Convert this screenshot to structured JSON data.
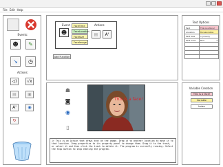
{
  "menu": [
    "File",
    "Edit",
    "Help"
  ],
  "left_panel": {
    "events_label": "Events:",
    "actions_label": "Actions:"
  },
  "editor": {
    "event_label": "Event",
    "actions_label": "Actions",
    "event_options": [
      "FaceTime",
      "FaceLocation",
      "FaceSize",
      "FaceImage"
    ],
    "add_function": "Add Function"
  },
  "text_options": {
    "title": "Text Options",
    "rows": [
      {
        "key": "Text",
        "value": "This is a face!"
      },
      {
        "key": "Location",
        "value": "FaceLocation"
      },
      {
        "key": "Text Size",
        "value": "1 (count)"
      },
      {
        "key": "Text Color",
        "value": "Red"
      }
    ]
  },
  "variable_creation": {
    "title": "Variable Creation",
    "items": [
      "This is a face!",
      "Variable",
      "Index"
    ]
  },
  "video_overlay_text": "This is a face!",
  "code_text": "1> This is an Action that draws text on the image. Drag it to another location to move it to that location. Drag properties to its property panel to change them. Drag it to the trash, or select it and then click the trash to delete it. The program is currently running. Select the Stop button to stop editing the program."
}
